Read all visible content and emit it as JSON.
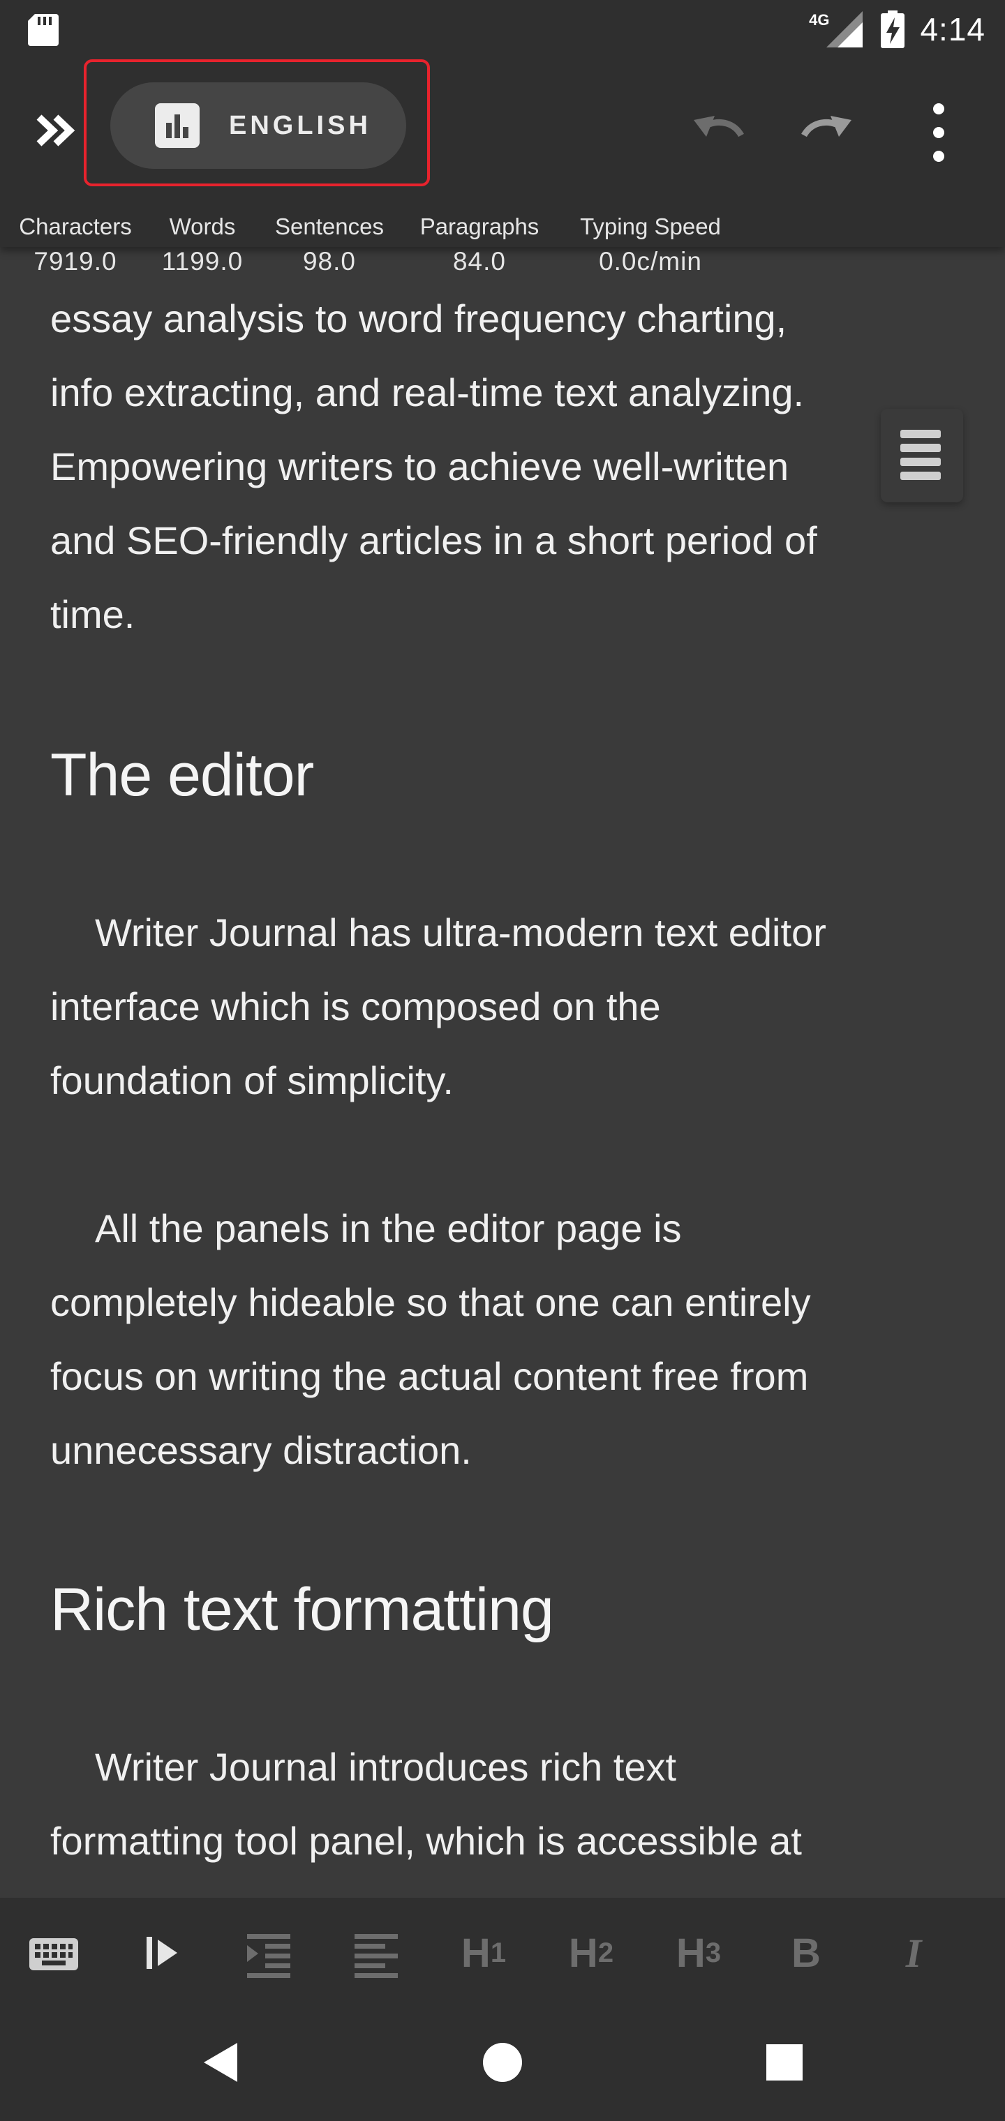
{
  "status_bar": {
    "network": "4G",
    "time": "4:14"
  },
  "toolbar": {
    "language_label": "ENGLISH"
  },
  "stats": [
    {
      "label": "Characters",
      "value": "7919.0"
    },
    {
      "label": "Words",
      "value": "1199.0"
    },
    {
      "label": "Sentences",
      "value": "98.0"
    },
    {
      "label": "Paragraphs",
      "value": "84.0"
    },
    {
      "label": "Typing Speed",
      "value": "0.0c/min"
    }
  ],
  "document": {
    "lines": [
      "essay analysis to word frequency charting,",
      "info extracting, and real-time text analyzing.",
      "Empowering  writers to achieve well-written",
      "and SEO-friendly articles in a short period of",
      "time."
    ],
    "heading_1": "The editor",
    "para_1": [
      "Writer Journal has ultra-modern text editor",
      "interface which is composed on the",
      "foundation of simplicity."
    ],
    "para_2": [
      "All the panels in the editor page is",
      "completely hideable so that one can entirely",
      "focus on writing the actual content free from",
      "unnecessary distraction."
    ],
    "heading_2": "Rich text formatting",
    "para_3": [
      "Writer Journal introduces rich text",
      "formatting tool panel, which is accessible at"
    ]
  },
  "format_toolbar": {
    "h1": "H",
    "h1_sub": "1",
    "h2": "H",
    "h2_sub": "2",
    "h3": "H",
    "h3_sub": "3",
    "bold": "B",
    "italic": "I"
  }
}
